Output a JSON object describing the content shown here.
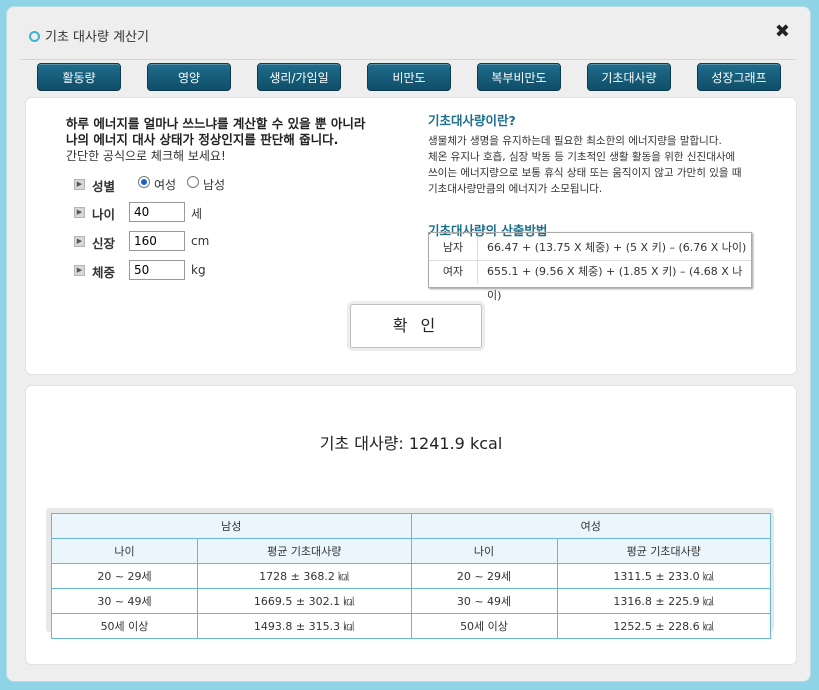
{
  "title": "기초 대사량 계산기",
  "close_glyph": "✖",
  "tabs": [
    "활동량",
    "영양",
    "생리/가임일",
    "비만도",
    "복부비만도",
    "기초대사량",
    "성장그래프"
  ],
  "intro": {
    "line1": "하루 에너지를 얼마나 쓰느냐를 계산할 수 있을 뿐 아니라",
    "line2": "나의 에너지 대사 상태가 정상인지를 판단해 줍니다.",
    "line3": "간단한 공식으로 체크해 보세요!"
  },
  "form": {
    "gender_label": "성별",
    "female": "여성",
    "male": "남성",
    "age_label": "나이",
    "age_value": "40",
    "age_unit": "세",
    "height_label": "신장",
    "height_value": "160",
    "height_unit": "cm",
    "weight_label": "체중",
    "weight_value": "50",
    "weight_unit": "kg",
    "bullet": "▶"
  },
  "info": {
    "heading": "기초대사량이란?",
    "lines": [
      "생물체가 생명을 유지하는데 필요한 최소한의 에너지량을 말합니다.",
      "체온 유지나 호흡, 심장 박동 등 기초적인 생활 활동을 위한 신진대사에",
      "쓰이는 에너지량으로 보통 휴식 상태 또는 움직이지 않고 가만히 있을 때",
      "기초대사량만큼의 에너지가 소모됩니다."
    ],
    "method_heading": "기초대사량의 산출방법",
    "formula_male_label": "남자",
    "formula_male": "66.47 + (13.75 X 체중) + (5 X 키) – (6.76 X 나이)",
    "formula_female_label": "여자",
    "formula_female": "655.1 + (9.56 X 체중) + (1.85 X 키) – (4.68 X 나이)"
  },
  "confirm_label": "확 인",
  "result": {
    "text": "기초 대사량: 1241.9 kcal"
  },
  "table": {
    "male_header": "남성",
    "female_header": "여성",
    "col_age": "나이",
    "col_avg": "평균 기초대사량",
    "rows": [
      {
        "age": "20 ~ 29세",
        "male": "1728 ± 368.2 ㎉",
        "female": "1311.5 ± 233.0 ㎉"
      },
      {
        "age": "30 ~ 49세",
        "male": "1669.5 ± 302.1 ㎉",
        "female": "1316.8 ± 225.9 ㎉"
      },
      {
        "age": "50세 이상",
        "male": "1493.8 ± 315.3 ㎉",
        "female": "1252.5 ± 228.6 ㎉"
      }
    ]
  }
}
